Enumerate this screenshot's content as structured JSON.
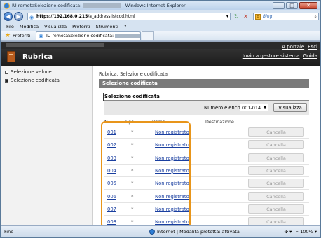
{
  "window": {
    "title_prefix": "IU remotaSelezione codificata:",
    "title_suffix": "- Windows Internet Explorer",
    "minimize": "–",
    "maximize": "□",
    "close": "✕"
  },
  "address": {
    "url_host": "https://192.168.0.215",
    "url_path": "/a_addresslistcod.html",
    "search_engine": "Bing",
    "back": "◀",
    "forward": "▶",
    "refresh": "↻",
    "stop": "✕",
    "dropdown": "▾"
  },
  "menu": [
    "File",
    "Modifica",
    "Visualizza",
    "Preferiti",
    "Strumenti",
    "?"
  ],
  "favorites": {
    "label": "Preferiti",
    "tab_label": "IU remotaSelezione codificata:"
  },
  "banner": {
    "title": "Rubrica",
    "link_portal": "A portale",
    "link_exit": "Esci",
    "link_admin": "Invio a gestore sistema",
    "link_help": "Guida"
  },
  "sidebar": {
    "items": [
      {
        "label": "Selezione veloce",
        "selected": false
      },
      {
        "label": "Selezione codificata",
        "selected": true
      }
    ]
  },
  "main": {
    "breadcrumb": "Rubrica: Selezione codificata",
    "bar_title": "Selezione codificata",
    "section_title": "Selezione codificata",
    "list_label": "Numero elenco:",
    "list_value": "001-014",
    "view_button": "Visualizza",
    "columns": [
      "N.",
      "Tipo",
      "Nome",
      "Destinazione"
    ],
    "rows": [
      {
        "n": "001",
        "type": "*",
        "name": "Non registrato",
        "delete": "Cancella"
      },
      {
        "n": "002",
        "type": "*",
        "name": "Non registrato",
        "delete": "Cancella"
      },
      {
        "n": "003",
        "type": "*",
        "name": "Non registrato",
        "delete": "Cancella"
      },
      {
        "n": "004",
        "type": "*",
        "name": "Non registrato",
        "delete": "Cancella"
      },
      {
        "n": "005",
        "type": "*",
        "name": "Non registrato",
        "delete": "Cancella"
      },
      {
        "n": "006",
        "type": "*",
        "name": "Non registrato",
        "delete": "Cancella"
      },
      {
        "n": "007",
        "type": "*",
        "name": "Non registrato",
        "delete": "Cancella"
      },
      {
        "n": "008",
        "type": "*",
        "name": "Non registrato",
        "delete": "Cancella"
      }
    ]
  },
  "status": {
    "left": "Fine",
    "zone": "Internet | Modalità protetta: attivata",
    "zoom": "100%"
  },
  "colors": {
    "highlight": "#e8951a",
    "banner": "#1c1c1c",
    "bar": "#7a7a7a",
    "link": "#1a3fa0"
  }
}
